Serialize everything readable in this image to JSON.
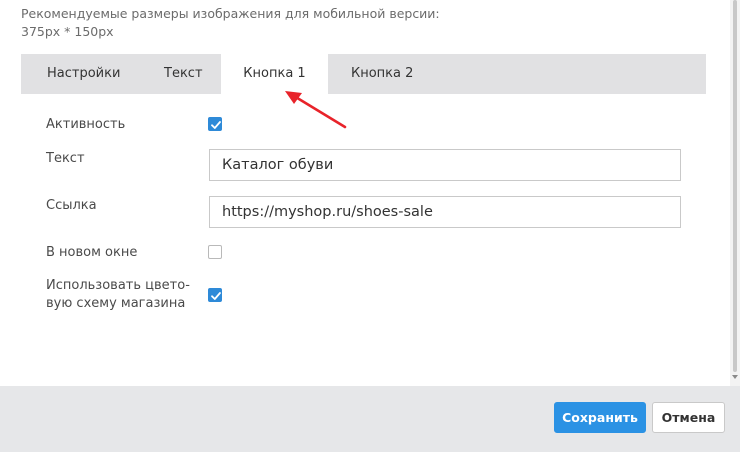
{
  "hint": {
    "line1": "Рекомендуемые размеры изображения для мобильной версии:",
    "line2": "375px * 150px"
  },
  "tabs": [
    {
      "label": "Настройки",
      "active": false
    },
    {
      "label": "Текст",
      "active": false
    },
    {
      "label": "Кнопка 1",
      "active": true
    },
    {
      "label": "Кнопка 2",
      "active": false
    }
  ],
  "form": {
    "activity": {
      "label": "Активность",
      "checked": true
    },
    "text": {
      "label": "Текст",
      "value": "Каталог обуви"
    },
    "link": {
      "label": "Ссылка",
      "value": "https://myshop.ru/shoes-sale"
    },
    "new_window": {
      "label": "В новом окне",
      "checked": false
    },
    "store_colors": {
      "label_line1": "Использовать цвето-",
      "label_line2": "вую схему магазина",
      "checked": true
    }
  },
  "footer": {
    "save_label": "Сохранить",
    "cancel_label": "Отмена"
  },
  "colors": {
    "accent": "#2b92e4",
    "arrow": "#e8232a"
  }
}
